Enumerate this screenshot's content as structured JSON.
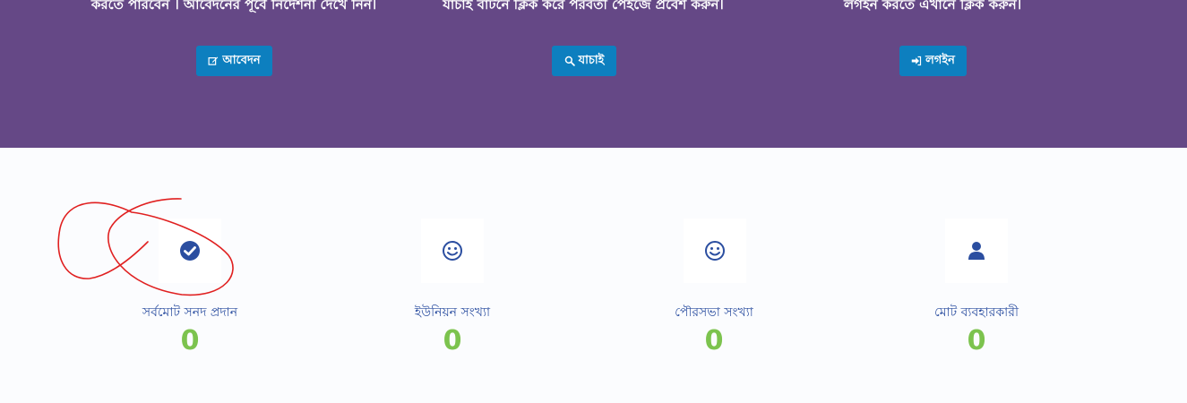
{
  "hero": {
    "columns": [
      {
        "text": "করতে পারবেন । আবেদনের পূর্বে নির্দেশনা দেখে নিন।",
        "button_label": "আবেদন",
        "button_icon": "edit-icon"
      },
      {
        "text": "যাচাই বাটনে ক্লিক করে পরবর্তী পেইজে প্রবেশ করুন।",
        "button_label": "যাচাই",
        "button_icon": "search-icon"
      },
      {
        "text": "লগইন করতে এখানে ক্লিক করুন।",
        "button_label": "লগইন",
        "button_icon": "sign-in-icon"
      }
    ],
    "background": "#654886",
    "button_color": "#0d7fbf"
  },
  "stats": [
    {
      "label": "সর্বমোট সনদ প্রদান",
      "count": "0",
      "icon": "check-circle-icon"
    },
    {
      "label": "ইউনিয়ন সংখ্যা",
      "count": "0",
      "icon": "smiley-icon"
    },
    {
      "label": "পৌরসভা সংখ্যা",
      "count": "0",
      "icon": "smiley-icon"
    },
    {
      "label": "মোট ব্যবহারকারী",
      "count": "0",
      "icon": "user-icon"
    }
  ],
  "colors": {
    "stat_label": "#2b4ea0",
    "stat_count": "#7cc34e",
    "annotation": "#e02020"
  }
}
